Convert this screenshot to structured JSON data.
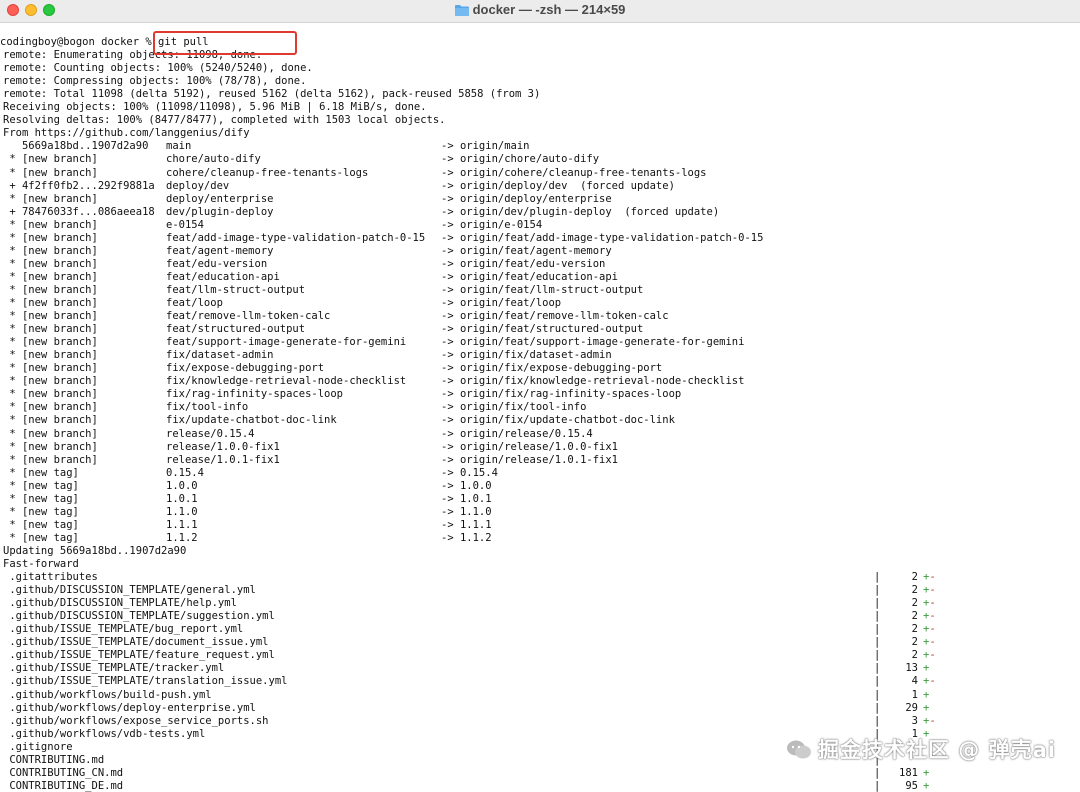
{
  "window": {
    "title": "docker — -zsh — 214×59"
  },
  "prompt": "codingboy@bogon docker % ",
  "command": "git pull",
  "preamble": [
    "remote: Enumerating objects: 11098, done.",
    "remote: Counting objects: 100% (5240/5240), done.",
    "remote: Compressing objects: 100% (78/78), done.",
    "remote: Total 11098 (delta 5192), reused 5162 (delta 5162), pack-reused 5858 (from 3)",
    "Receiving objects: 100% (11098/11098), 5.96 MiB | 6.18 MiB/s, done.",
    "Resolving deltas: 100% (8477/8477), completed with 1503 local objects.",
    "From https://github.com/langgenius/dify"
  ],
  "refs": [
    {
      "a": "   5669a18bd..1907d2a90",
      "b": "main",
      "c": "-> origin/main"
    },
    {
      "a": " * [new branch]",
      "b": "chore/auto-dify",
      "c": "-> origin/chore/auto-dify"
    },
    {
      "a": " * [new branch]",
      "b": "cohere/cleanup-free-tenants-logs",
      "c": "-> origin/cohere/cleanup-free-tenants-logs"
    },
    {
      "a": " + 4f2ff0fb2...292f9881a",
      "b": "deploy/dev",
      "c": "-> origin/deploy/dev  (forced update)"
    },
    {
      "a": " * [new branch]",
      "b": "deploy/enterprise",
      "c": "-> origin/deploy/enterprise"
    },
    {
      "a": " + 78476033f...086aeea18",
      "b": "dev/plugin-deploy",
      "c": "-> origin/dev/plugin-deploy  (forced update)"
    },
    {
      "a": " * [new branch]",
      "b": "e-0154",
      "c": "-> origin/e-0154"
    },
    {
      "a": " * [new branch]",
      "b": "feat/add-image-type-validation-patch-0-15",
      "c": "-> origin/feat/add-image-type-validation-patch-0-15"
    },
    {
      "a": " * [new branch]",
      "b": "feat/agent-memory",
      "c": "-> origin/feat/agent-memory"
    },
    {
      "a": " * [new branch]",
      "b": "feat/edu-version",
      "c": "-> origin/feat/edu-version"
    },
    {
      "a": " * [new branch]",
      "b": "feat/education-api",
      "c": "-> origin/feat/education-api"
    },
    {
      "a": " * [new branch]",
      "b": "feat/llm-struct-output",
      "c": "-> origin/feat/llm-struct-output"
    },
    {
      "a": " * [new branch]",
      "b": "feat/loop",
      "c": "-> origin/feat/loop"
    },
    {
      "a": " * [new branch]",
      "b": "feat/remove-llm-token-calc",
      "c": "-> origin/feat/remove-llm-token-calc"
    },
    {
      "a": " * [new branch]",
      "b": "feat/structured-output",
      "c": "-> origin/feat/structured-output"
    },
    {
      "a": " * [new branch]",
      "b": "feat/support-image-generate-for-gemini",
      "c": "-> origin/feat/support-image-generate-for-gemini"
    },
    {
      "a": " * [new branch]",
      "b": "fix/dataset-admin",
      "c": "-> origin/fix/dataset-admin"
    },
    {
      "a": " * [new branch]",
      "b": "fix/expose-debugging-port",
      "c": "-> origin/fix/expose-debugging-port"
    },
    {
      "a": " * [new branch]",
      "b": "fix/knowledge-retrieval-node-checklist",
      "c": "-> origin/fix/knowledge-retrieval-node-checklist"
    },
    {
      "a": " * [new branch]",
      "b": "fix/rag-infinity-spaces-loop",
      "c": "-> origin/fix/rag-infinity-spaces-loop"
    },
    {
      "a": " * [new branch]",
      "b": "fix/tool-info",
      "c": "-> origin/fix/tool-info"
    },
    {
      "a": " * [new branch]",
      "b": "fix/update-chatbot-doc-link",
      "c": "-> origin/fix/update-chatbot-doc-link"
    },
    {
      "a": " * [new branch]",
      "b": "release/0.15.4",
      "c": "-> origin/release/0.15.4"
    },
    {
      "a": " * [new branch]",
      "b": "release/1.0.0-fix1",
      "c": "-> origin/release/1.0.0-fix1"
    },
    {
      "a": " * [new branch]",
      "b": "release/1.0.1-fix1",
      "c": "-> origin/release/1.0.1-fix1"
    },
    {
      "a": " * [new tag]",
      "b": "0.15.4",
      "c": "-> 0.15.4"
    },
    {
      "a": " * [new tag]",
      "b": "1.0.0",
      "c": "-> 1.0.0"
    },
    {
      "a": " * [new tag]",
      "b": "1.0.1",
      "c": "-> 1.0.1"
    },
    {
      "a": " * [new tag]",
      "b": "1.1.0",
      "c": "-> 1.1.0"
    },
    {
      "a": " * [new tag]",
      "b": "1.1.1",
      "c": "-> 1.1.1"
    },
    {
      "a": " * [new tag]",
      "b": "1.1.2",
      "c": "-> 1.1.2"
    }
  ],
  "updating": "Updating 5669a18bd..1907d2a90",
  "fastforward": "Fast-forward",
  "files": [
    {
      "name": " .gitattributes",
      "count": "2",
      "plus": "+",
      "minus": "-"
    },
    {
      "name": " .github/DISCUSSION_TEMPLATE/general.yml",
      "count": "2",
      "plus": "+",
      "minus": "-"
    },
    {
      "name": " .github/DISCUSSION_TEMPLATE/help.yml",
      "count": "2",
      "plus": "+",
      "minus": "-"
    },
    {
      "name": " .github/DISCUSSION_TEMPLATE/suggestion.yml",
      "count": "2",
      "plus": "+",
      "minus": "-"
    },
    {
      "name": " .github/ISSUE_TEMPLATE/bug_report.yml",
      "count": "2",
      "plus": "+",
      "minus": "-"
    },
    {
      "name": " .github/ISSUE_TEMPLATE/document_issue.yml",
      "count": "2",
      "plus": "+",
      "minus": "-"
    },
    {
      "name": " .github/ISSUE_TEMPLATE/feature_request.yml",
      "count": "2",
      "plus": "+",
      "minus": "-"
    },
    {
      "name": " .github/ISSUE_TEMPLATE/tracker.yml",
      "count": "13",
      "plus": "+",
      "minus": ""
    },
    {
      "name": " .github/ISSUE_TEMPLATE/translation_issue.yml",
      "count": "4",
      "plus": "+",
      "minus": "-"
    },
    {
      "name": " .github/workflows/build-push.yml",
      "count": "1",
      "plus": "+",
      "minus": ""
    },
    {
      "name": " .github/workflows/deploy-enterprise.yml",
      "count": "29",
      "plus": "+",
      "minus": ""
    },
    {
      "name": " .github/workflows/expose_service_ports.sh",
      "count": "3",
      "plus": "+",
      "minus": "-"
    },
    {
      "name": " .github/workflows/vdb-tests.yml",
      "count": "1",
      "plus": "+",
      "minus": ""
    },
    {
      "name": " .gitignore",
      "count": "",
      "plus": "",
      "minus": ""
    },
    {
      "name": " CONTRIBUTING.md",
      "count": "",
      "plus": "",
      "minus": ""
    },
    {
      "name": " CONTRIBUTING_CN.md",
      "count": "181",
      "plus": "+",
      "minus": ""
    },
    {
      "name": " CONTRIBUTING_DE.md",
      "count": "95",
      "plus": "+",
      "minus": ""
    }
  ],
  "watermark": "掘金技术社区 @ 弹壳ai",
  "colors": {
    "close": "#fe5f57",
    "minimize": "#febc2e",
    "maximize": "#28c840",
    "highlight": "#e0392f",
    "diff_plus": "#3a9a3a"
  }
}
